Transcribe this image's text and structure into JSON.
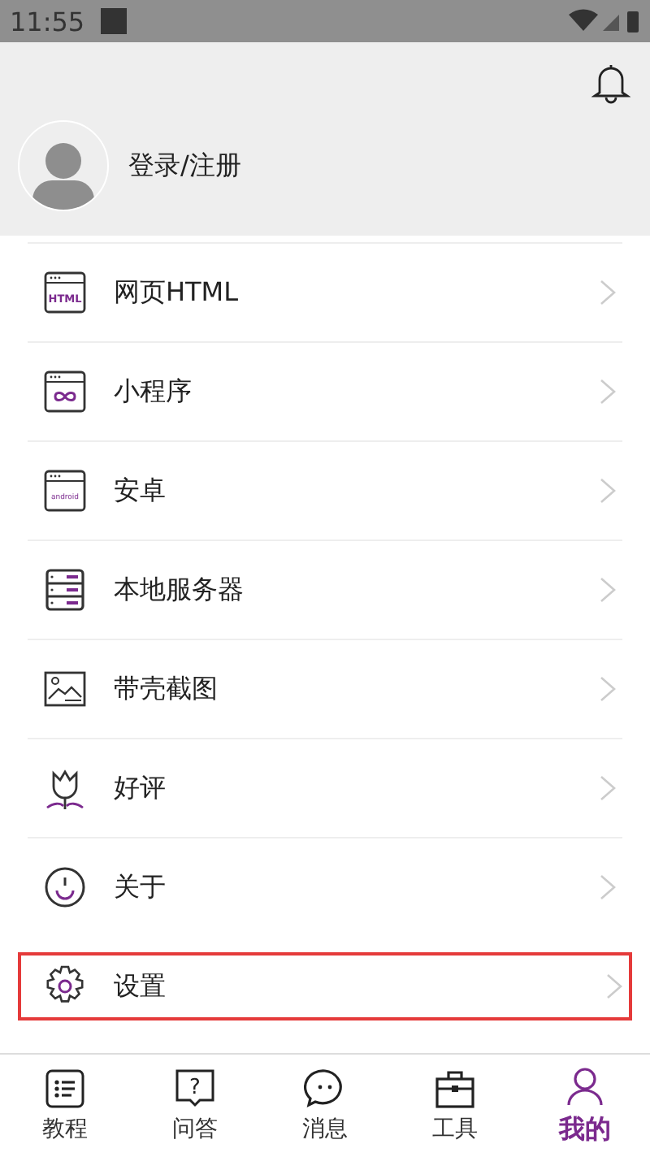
{
  "status_bar": {
    "time": "11:55"
  },
  "profile": {
    "login_label": "登录/注册"
  },
  "menu": [
    {
      "label": "网页HTML",
      "kind": "html",
      "icon_text": "HTML",
      "highlighted": false
    },
    {
      "label": "小程序",
      "kind": "mini",
      "highlighted": false
    },
    {
      "label": "安卓",
      "kind": "android",
      "icon_text": "android",
      "highlighted": false
    },
    {
      "label": "本地服务器",
      "kind": "server",
      "highlighted": false
    },
    {
      "label": "带壳截图",
      "kind": "image",
      "highlighted": false
    },
    {
      "label": "好评",
      "kind": "tulip",
      "highlighted": false
    },
    {
      "label": "关于",
      "kind": "smile",
      "highlighted": false
    },
    {
      "label": "设置",
      "kind": "gear",
      "highlighted": true
    }
  ],
  "bottom_nav": [
    {
      "label": "教程",
      "kind": "list",
      "selected": false
    },
    {
      "label": "问答",
      "kind": "question",
      "glyph": "?",
      "selected": false
    },
    {
      "label": "消息",
      "kind": "chat",
      "selected": false
    },
    {
      "label": "工具",
      "kind": "toolbox",
      "selected": false
    },
    {
      "label": "我的",
      "kind": "person",
      "selected": true
    }
  ]
}
